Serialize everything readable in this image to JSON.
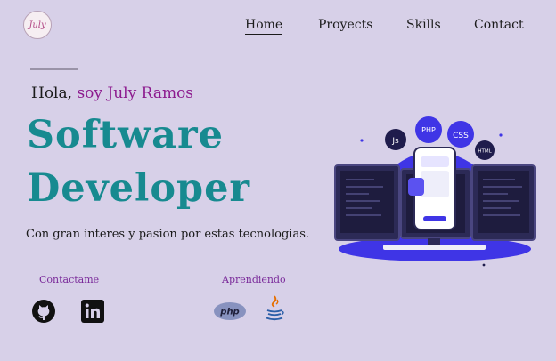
{
  "logo": {
    "text": "July"
  },
  "nav": {
    "items": [
      "Home",
      "Proyects",
      "Skills",
      "Contact"
    ],
    "active": "Home"
  },
  "hero": {
    "greeting": "Hola,",
    "name": "soy July Ramos",
    "title_line1": "Software",
    "title_line2": "Developer",
    "subtitle": "Con gran interes y pasion por estas tecnologias."
  },
  "contact": {
    "label": "Contactame",
    "icons": [
      "github-icon",
      "linkedin-icon"
    ]
  },
  "learning": {
    "label": "Aprendiendo",
    "icons": [
      "php-icon",
      "java-icon"
    ]
  },
  "illustration": {
    "bubbles": [
      "Js",
      "PHP",
      "CSS",
      "HTML"
    ]
  },
  "colors": {
    "background": "#d7d0e8",
    "accent_teal": "#178a90",
    "accent_purple": "#8c1a8e",
    "illustration_blue": "#3f35e6"
  }
}
